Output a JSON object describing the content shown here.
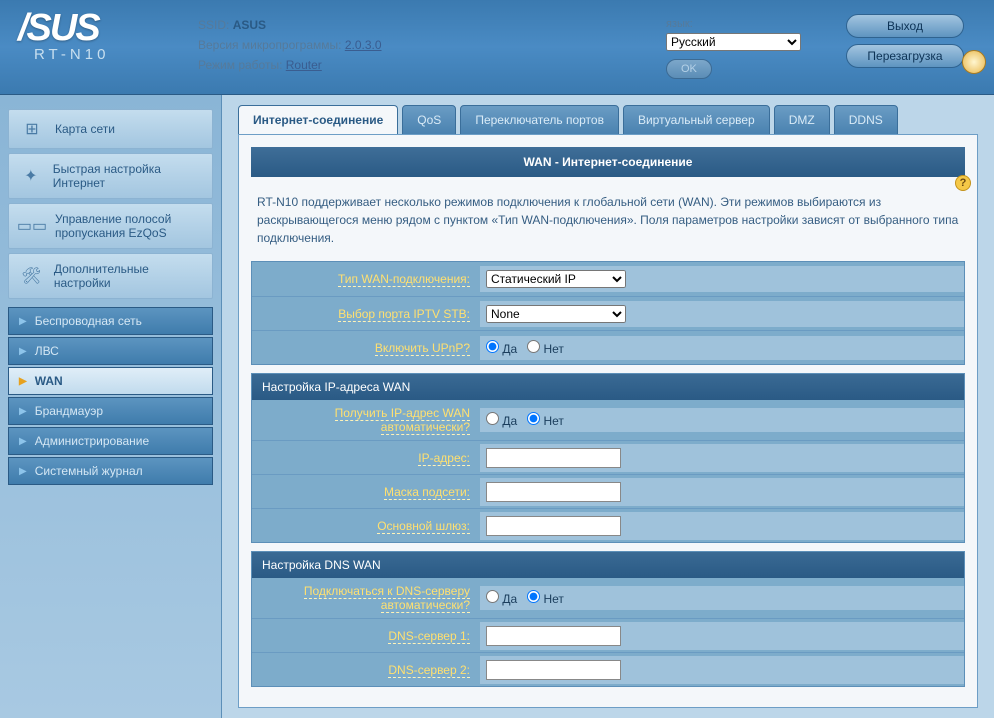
{
  "header": {
    "brand": "/SUS",
    "model": "RT-N10",
    "ssid_label": "SSID:",
    "ssid": "ASUS",
    "fw_label": "Версия микропрограммы:",
    "fw": "2.0.3.0",
    "mode_label": "Режим работы:",
    "mode": "Router",
    "lang_label": "язык:",
    "lang": "Русский",
    "lang_ok": "OK",
    "logout": "Выход",
    "reboot": "Перезагрузка"
  },
  "sidebar": {
    "main": [
      {
        "icon": "⊞",
        "label": "Карта сети"
      },
      {
        "icon": "✦",
        "label": "Быстрая настройка Интернет"
      },
      {
        "icon": "▭▭",
        "label": "Управление полосой пропускания EzQoS"
      },
      {
        "icon": "🛠",
        "label": "Дополнительные настройки"
      }
    ],
    "sub": [
      {
        "label": "Беспроводная сеть",
        "active": false
      },
      {
        "label": "ЛВС",
        "active": false
      },
      {
        "label": "WAN",
        "active": true
      },
      {
        "label": "Брандмауэр",
        "active": false
      },
      {
        "label": "Администрирование",
        "active": false
      },
      {
        "label": "Системный журнал",
        "active": false
      }
    ]
  },
  "tabs": [
    "Интернет-соединение",
    "QoS",
    "Переключатель портов",
    "Виртуальный сервер",
    "DMZ",
    "DDNS"
  ],
  "active_tab": 0,
  "panel": {
    "title": "WAN - Интернет-соединение",
    "desc": "RT-N10 поддерживает несколько режимов подключения к глобальной сети (WAN). Эти режимов выбираются из раскрывающегося меню рядом с пунктом «Тип WAN-подключения». Поля параметров настройки зависят от выбранного типа подключения.",
    "help": "?"
  },
  "form": {
    "top": [
      {
        "label": "Тип WAN-подключения:",
        "type": "select",
        "value": "Статический IP"
      },
      {
        "label": "Выбор порта IPTV STB:",
        "type": "select",
        "value": "None"
      },
      {
        "label": "Включить UPnP?",
        "type": "radio",
        "yes": "Да",
        "no": "Нет",
        "sel": "yes"
      }
    ],
    "ip_section": {
      "title": "Настройка IP-адреса WAN",
      "rows": [
        {
          "label": "Получить IP-адрес WAN автоматически?",
          "type": "radio",
          "yes": "Да",
          "no": "Нет",
          "sel": "no"
        },
        {
          "label": "IP-адрес:",
          "type": "text",
          "value": ""
        },
        {
          "label": "Маска подсети:",
          "type": "text",
          "value": ""
        },
        {
          "label": "Основной шлюз:",
          "type": "text",
          "value": ""
        }
      ]
    },
    "dns_section": {
      "title": "Настройка DNS WAN",
      "rows": [
        {
          "label": "Подключаться к DNS-серверу автоматически?",
          "type": "radio",
          "yes": "Да",
          "no": "Нет",
          "sel": "no"
        },
        {
          "label": "DNS-сервер 1:",
          "type": "text",
          "value": ""
        },
        {
          "label": "DNS-сервер 2:",
          "type": "text",
          "value": ""
        }
      ]
    }
  }
}
